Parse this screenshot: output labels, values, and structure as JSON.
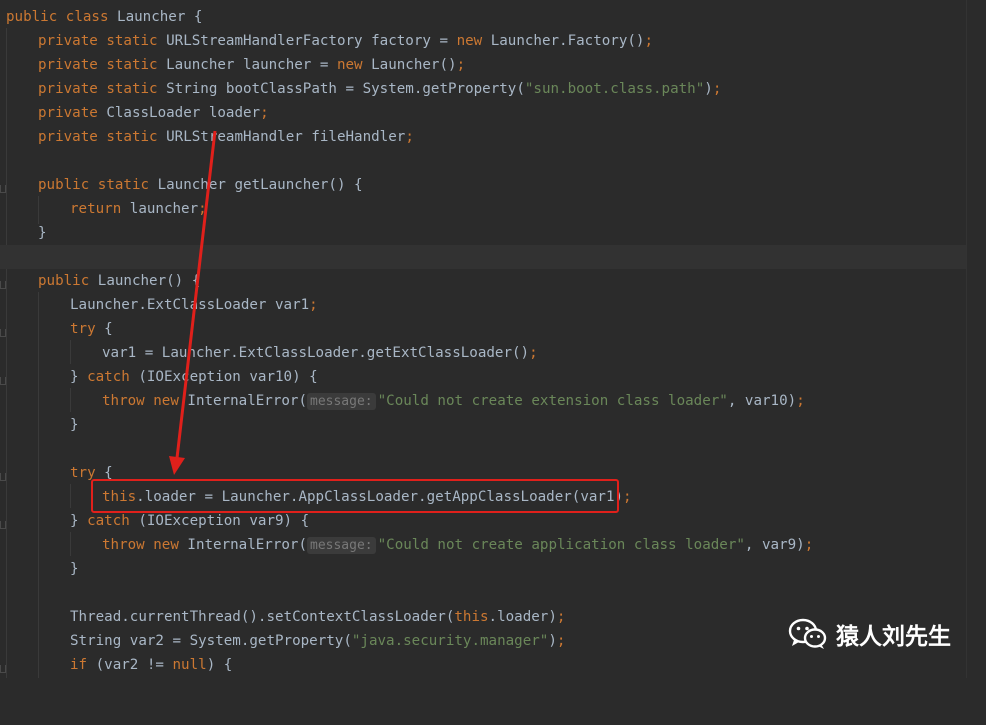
{
  "colors": {
    "background": "#2b2b2b",
    "keyword": "#cc7832",
    "string": "#6a8759",
    "identifier": "#a9b7c6",
    "annotation_box": "#e0201b"
  },
  "code": {
    "l1": {
      "kw": "public class",
      "t": " Launcher {"
    },
    "l2": {
      "kw": "private static",
      "t1": " URLStreamHandlerFactory factory = ",
      "kw2": "new",
      "t2": " Launcher.Factory()",
      "p": ";"
    },
    "l3": {
      "kw": "private static",
      "t1": " Launcher launcher = ",
      "kw2": "new",
      "t2": " Launcher()",
      "p": ";"
    },
    "l4": {
      "kw": "private static",
      "t1": " String bootClassPath = System.getProperty(",
      "s": "\"sun.boot.class.path\"",
      "t2": ")",
      "p": ";"
    },
    "l5": {
      "kw": "private",
      "t": " ClassLoader loader",
      "p": ";"
    },
    "l6": {
      "kw": "private static",
      "t": " URLStreamHandler fileHandler",
      "p": ";"
    },
    "l8": {
      "kw": "public static",
      "t": " Launcher getLauncher() {"
    },
    "l9": {
      "kw": "return",
      "t": " launcher",
      "p": ";"
    },
    "l10": {
      "t": "}"
    },
    "l12": {
      "kw": "public",
      "t": " Launcher() {"
    },
    "l13": {
      "t": "Launcher.ExtClassLoader var1",
      "p": ";"
    },
    "l14": {
      "kw": "try",
      "t": " {"
    },
    "l15": {
      "t1": "var1 = Launcher.ExtClassLoader.getExtClassLoader()",
      "p": ";"
    },
    "l16": {
      "t1": "} ",
      "kw": "catch",
      "t2": " (IOException var10) {"
    },
    "l17": {
      "kw": "throw new",
      "t1": " InternalError(",
      "hint": "message:",
      "s": "\"Could not create extension class loader\"",
      "t2": ", var10)",
      "p": ";"
    },
    "l18": {
      "t": "}"
    },
    "l20": {
      "kw": "try",
      "t": " {"
    },
    "l21": {
      "kw": "this",
      "t": ".loader = Launcher.AppClassLoader.getAppClassLoader(var1)",
      "p": ";"
    },
    "l22": {
      "t1": "} ",
      "kw": "catch",
      "t2": " (IOException var9) {"
    },
    "l23": {
      "kw": "throw new",
      "t1": " InternalError(",
      "hint": "message:",
      "s": "\"Could not create application class loader\"",
      "t2": ", var9)",
      "p": ";"
    },
    "l24": {
      "t": "}"
    },
    "l26": {
      "t1": "Thread.currentThread().setContextClassLoader(",
      "kw": "this",
      "t2": ".loader)",
      "p": ";"
    },
    "l27": {
      "t1": "String var2 = System.getProperty(",
      "s": "\"java.security.manager\"",
      "t2": ")",
      "p": ";"
    },
    "l28": {
      "kw": "if",
      "t1": " (var2 != ",
      "kw2": "null",
      "t2": ") {"
    }
  },
  "watermark": {
    "icon": "wechat-icon",
    "text": "猿人刘先生"
  }
}
